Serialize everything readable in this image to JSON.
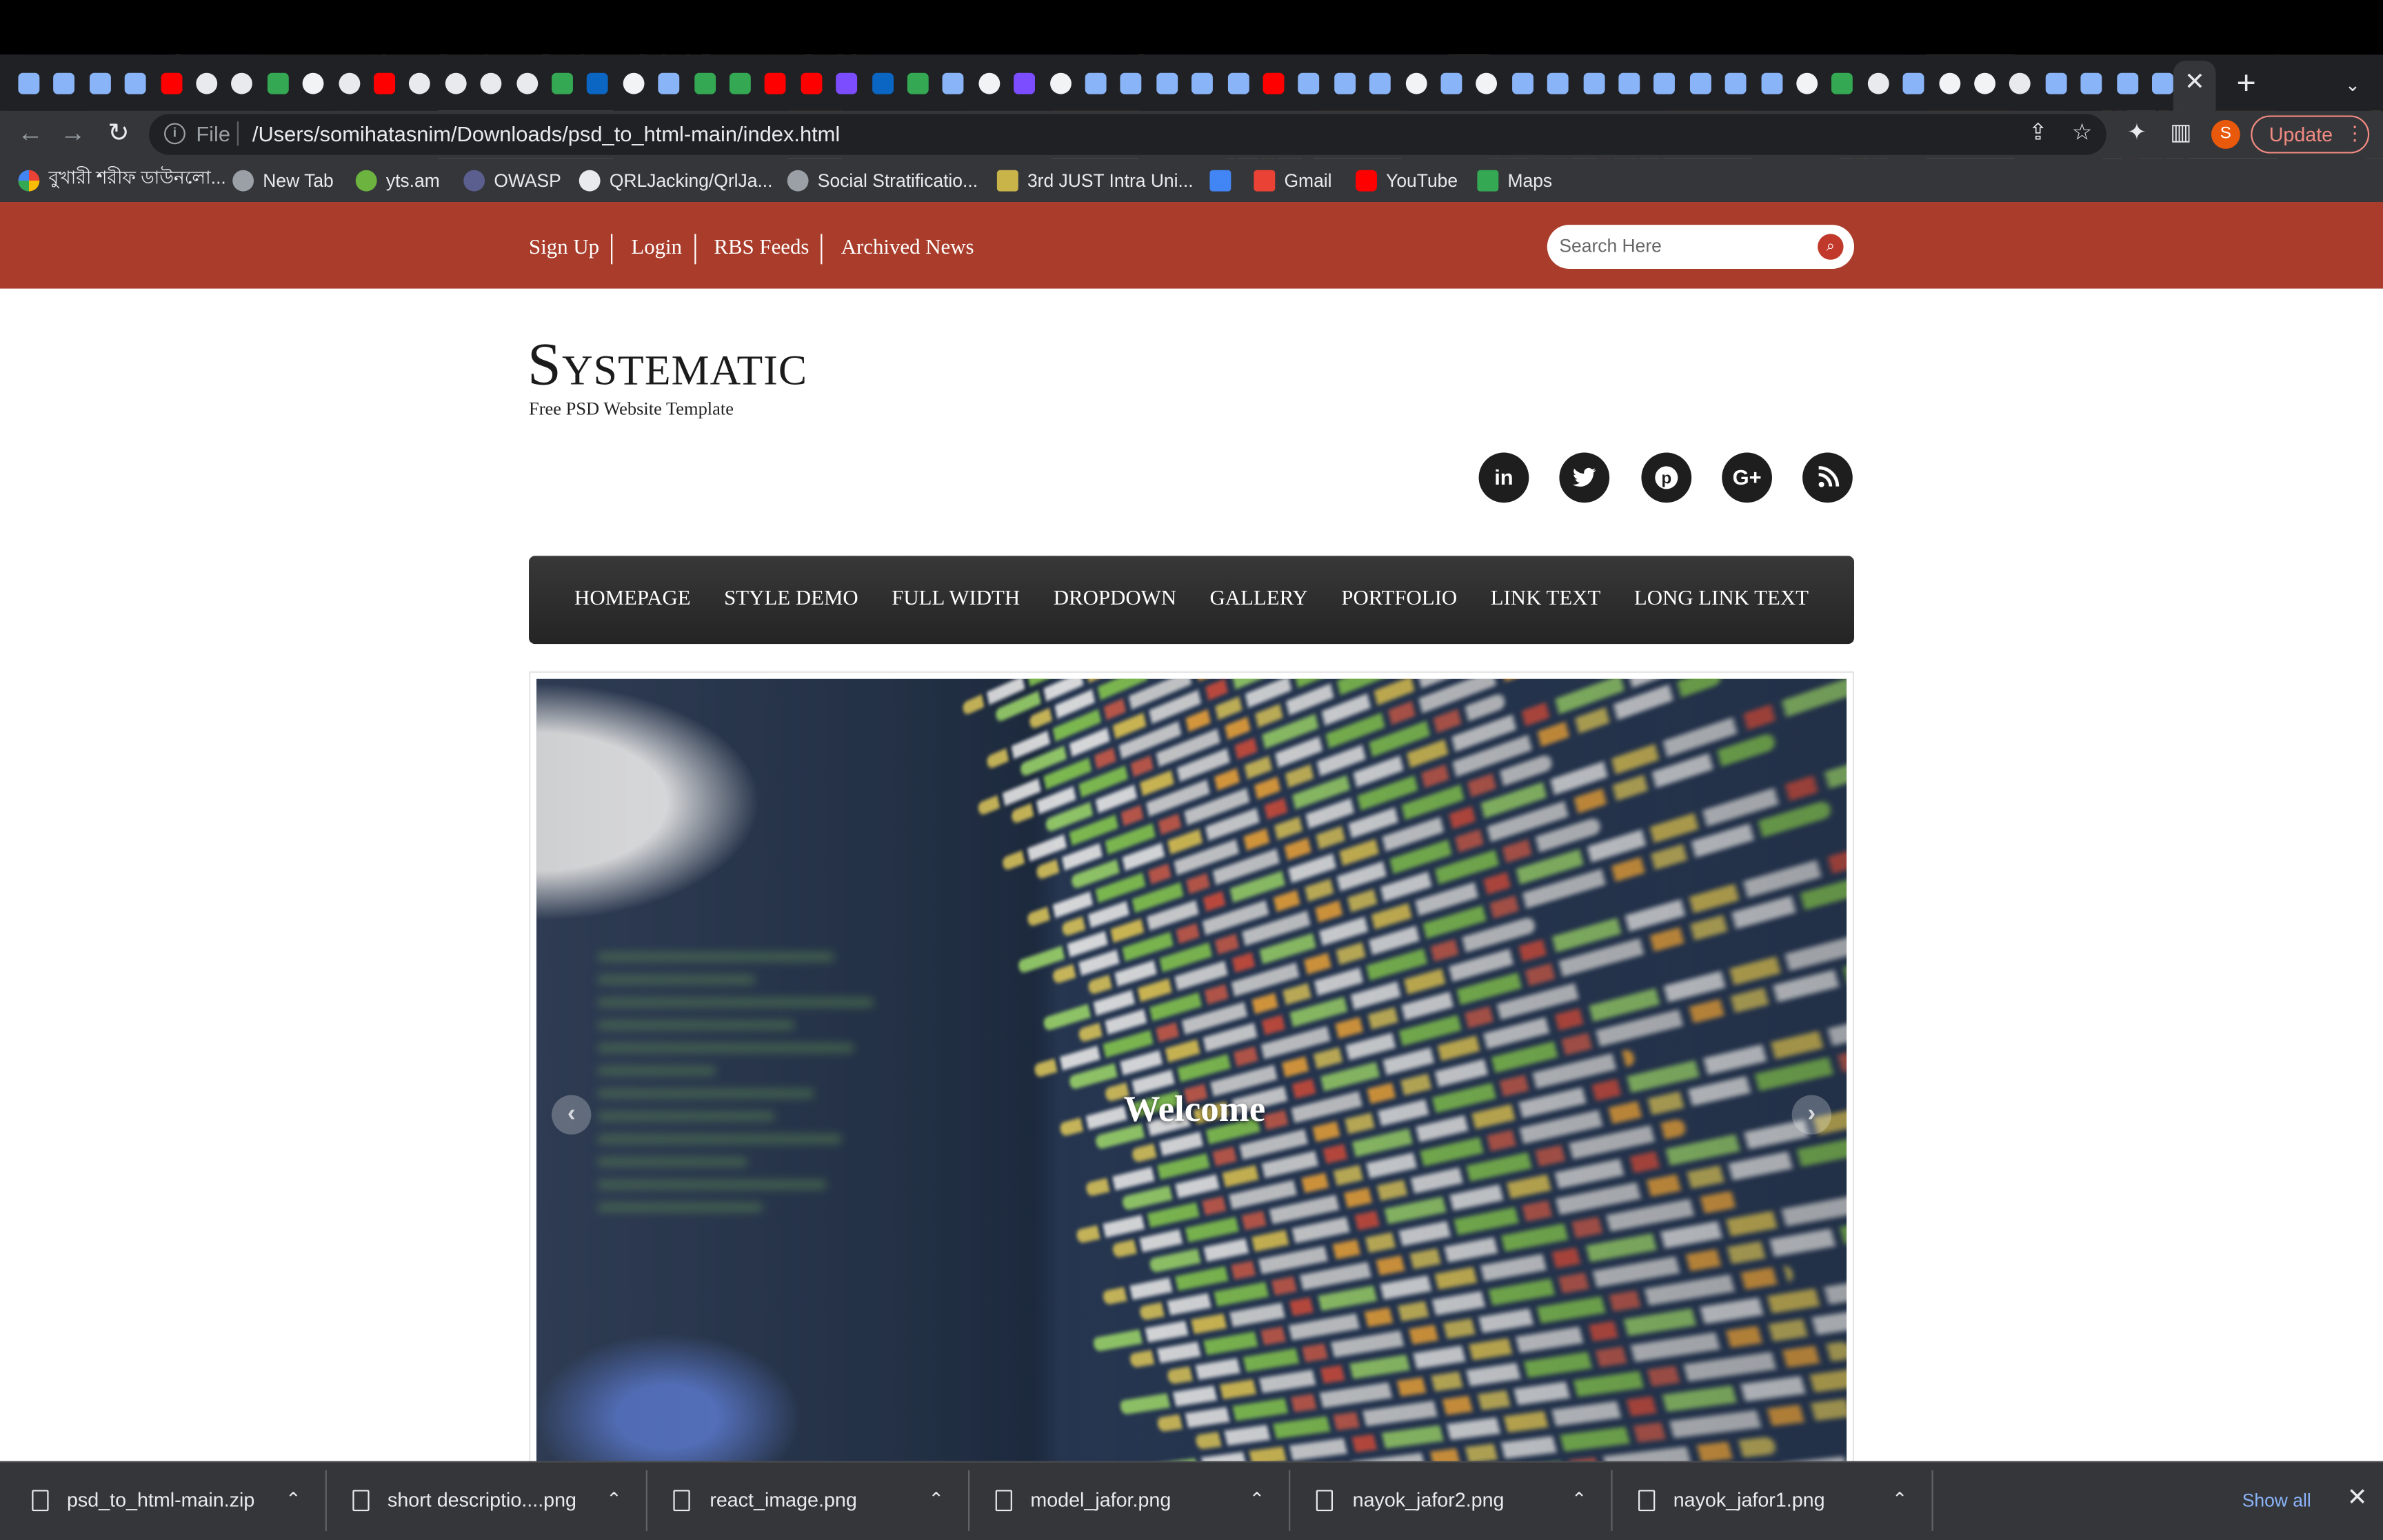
{
  "browser": {
    "file_label": "File",
    "url": "/Users/somihatasnim/Downloads/psd_to_html-main/index.html",
    "update_label": "Update",
    "avatar_letter": "S",
    "tab_close_icon": "close-icon",
    "new_tab_icon": "plus-icon"
  },
  "bookmarks": [
    {
      "label": "বুখারী শরীফ ডাউনলো...",
      "icon": "google-icon"
    },
    {
      "label": "New Tab",
      "icon": "globe-icon"
    },
    {
      "label": "yts.am",
      "icon": "yts-icon"
    },
    {
      "label": "OWASP",
      "icon": "owasp-icon"
    },
    {
      "label": "QRLJacking/QrlJa...",
      "icon": "github-icon"
    },
    {
      "label": "Social Stratificatio...",
      "icon": "globe-icon"
    },
    {
      "label": "3rd JUST Intra Uni...",
      "icon": "just-icon"
    },
    {
      "label": "",
      "icon": "docs-icon"
    },
    {
      "label": "Gmail",
      "icon": "gmail-icon"
    },
    {
      "label": "YouTube",
      "icon": "youtube-icon"
    },
    {
      "label": "Maps",
      "icon": "maps-icon"
    }
  ],
  "site": {
    "top_links": [
      "Sign Up",
      "Login",
      "RBS Feeds",
      "Archived News"
    ],
    "search_placeholder": "Search Here",
    "logo": "Systematic",
    "tagline": "Free PSD Website Template",
    "social": [
      {
        "name": "linkedin",
        "glyph": "in"
      },
      {
        "name": "twitter",
        "glyph": "🐦"
      },
      {
        "name": "pinterest",
        "glyph": "P"
      },
      {
        "name": "google-plus",
        "glyph": "G+"
      },
      {
        "name": "rss",
        "glyph": "◉"
      }
    ],
    "nav": [
      "HOMEPAGE",
      "STYLE DEMO",
      "FULL WIDTH",
      "DROPDOWN",
      "GALLERY",
      "PORTFOLIO",
      "LINK TEXT",
      "LONG LINK TEXT"
    ],
    "slider_caption": "Welcome",
    "brand_red": "#a93c2a",
    "nav_dark": "#2b2b2b"
  },
  "downloads": {
    "items": [
      "psd_to_html-main.zip",
      "short descriptio....png",
      "react_image.png",
      "model_jafor.png",
      "nayok_jafor2.png",
      "nayok_jafor1.png"
    ],
    "show_all": "Show all"
  }
}
